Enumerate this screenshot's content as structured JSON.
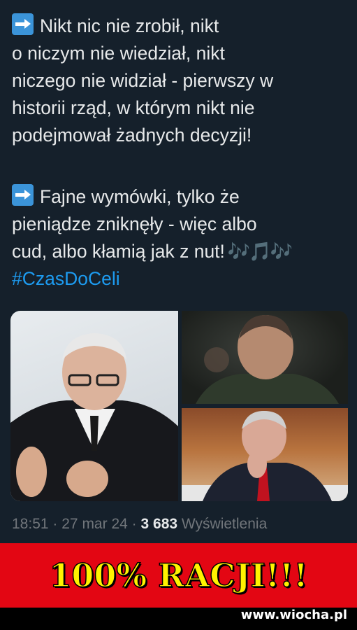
{
  "tweet": {
    "para1": {
      "lines": [
        "Nikt nic nie zrobił, nikt",
        "o niczym nie wiedział, nikt",
        "niczego nie widział - pierwszy w",
        "historii rząd, w którym nikt nie",
        "podejmował żadnych decyzji!"
      ]
    },
    "para2": {
      "lines": [
        "Fajne wymówki, tylko że",
        "pieniądze zniknęły - więc albo",
        "cud, albo kłamią jak z nut!"
      ],
      "emoji": "🎶🎵🎶",
      "hashtag": "#CzasDoCeli"
    },
    "meta": {
      "time": "18:51",
      "sep": "·",
      "date": "27 mar 24",
      "views_count": "3 683",
      "views_label": "Wyświetlenia"
    }
  },
  "banner": {
    "text": "100% RACJI!!!"
  },
  "footer": {
    "watermark": "www.wiocha.pl"
  },
  "colors": {
    "background": "#15202b",
    "text": "#e7e9ea",
    "muted": "#71767b",
    "link": "#1d9bf0",
    "banner_bg": "#e30613",
    "banner_text": "#fff200"
  },
  "icons": {
    "bullet": "right-arrow-icon",
    "emoji": "musical-notes-icon"
  }
}
